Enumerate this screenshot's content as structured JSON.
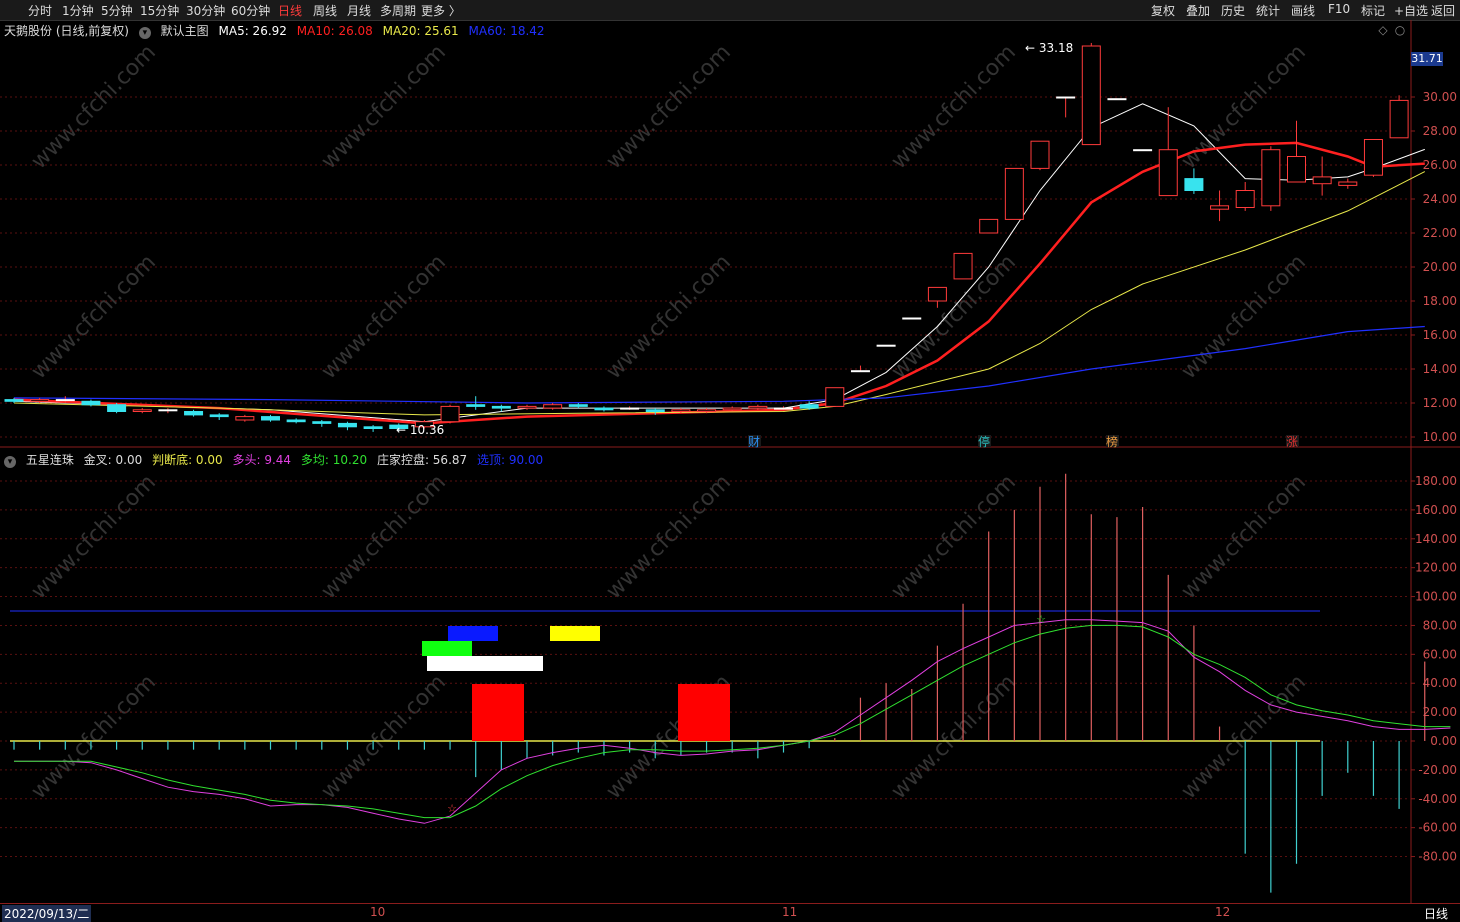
{
  "toolbar": {
    "periods": [
      "分时",
      "1分钟",
      "5分钟",
      "15分钟",
      "30分钟",
      "60分钟",
      "日线",
      "周线",
      "月线",
      "多周期",
      "更多 〉"
    ],
    "active": "日线",
    "right_buttons": [
      "复权",
      "叠加",
      "历史",
      "统计",
      "画线",
      "F10",
      "标记",
      "+自选",
      "返回"
    ]
  },
  "main_info": {
    "stock": "天鹅股份 (日线,前复权)",
    "template": "默认主图",
    "ma5": "MA5: 26.92",
    "ma10": "MA10: 26.08",
    "ma20": "MA20: 25.61",
    "ma60": "MA60: 18.42"
  },
  "colors": {
    "up": "#ff3b3b",
    "down": "#38e3ee",
    "ma5": "#ffffff",
    "ma10": "#ff2020",
    "ma20": "#e8e84a",
    "ma60": "#2030ff",
    "grid": "#5a1010",
    "axis": "#8a1c1c",
    "kdj_m": "#e040e0",
    "kdj_g": "#30e030"
  },
  "price_scale": {
    "highlight": "31.71",
    "ticks": [
      "30.00",
      "28.00",
      "26.00",
      "24.00",
      "22.00",
      "20.00",
      "18.00",
      "16.00",
      "14.00",
      "12.00",
      "10.00"
    ]
  },
  "annotations": {
    "high": "33.18",
    "low": "10.36"
  },
  "event_tags": [
    {
      "label": "财",
      "color": "#2a8ef0"
    },
    {
      "label": "停",
      "color": "#2ac0c0"
    },
    {
      "label": "榜",
      "color": "#e89a40"
    },
    {
      "label": "涨",
      "color": "#e03030"
    }
  ],
  "sub_info": {
    "name": "五星连珠",
    "jincha": "金叉: 0.00",
    "pandi": "判断底: 0.00",
    "duotou": "多头: 9.44",
    "duojun": "多均: 10.20",
    "kongpan": "庄家控盘: 56.87",
    "xuanding": "选顶: 90.00"
  },
  "sub_scale": {
    "ticks": [
      "180.00",
      "160.00",
      "140.00",
      "120.00",
      "100.00",
      "80.00",
      "60.00",
      "40.00",
      "20.00",
      "0.00",
      "-20.00",
      "-40.00",
      "-60.00",
      "-80.00"
    ]
  },
  "bottom": {
    "date": "2022/09/13/二",
    "months": [
      "10",
      "11",
      "12"
    ],
    "period": "日线"
  },
  "watermark": "www.cfchi.com",
  "chart_data": {
    "type": "candlestick",
    "price_ylim": [
      10,
      31.71
    ],
    "candles": [
      {
        "o": 12.2,
        "c": 12.1,
        "h": 12.3,
        "l": 12.0
      },
      {
        "o": 12.1,
        "c": 12.2,
        "h": 12.3,
        "l": 12.0
      },
      {
        "o": 12.2,
        "c": 12.2,
        "h": 12.4,
        "l": 12.0
      },
      {
        "o": 12.1,
        "c": 11.9,
        "h": 12.2,
        "l": 11.8
      },
      {
        "o": 11.9,
        "c": 11.5,
        "h": 12.0,
        "l": 11.4
      },
      {
        "o": 11.5,
        "c": 11.6,
        "h": 11.7,
        "l": 11.4
      },
      {
        "o": 11.6,
        "c": 11.6,
        "h": 11.7,
        "l": 11.4
      },
      {
        "o": 11.5,
        "c": 11.3,
        "h": 11.6,
        "l": 11.2
      },
      {
        "o": 11.3,
        "c": 11.2,
        "h": 11.4,
        "l": 11.0
      },
      {
        "o": 11.0,
        "c": 11.2,
        "h": 11.3,
        "l": 10.9
      },
      {
        "o": 11.2,
        "c": 11.0,
        "h": 11.3,
        "l": 10.9
      },
      {
        "o": 11.0,
        "c": 10.9,
        "h": 11.1,
        "l": 10.8
      },
      {
        "o": 10.9,
        "c": 10.8,
        "h": 11.0,
        "l": 10.6
      },
      {
        "o": 10.8,
        "c": 10.6,
        "h": 10.9,
        "l": 10.4
      },
      {
        "o": 10.6,
        "c": 10.5,
        "h": 10.7,
        "l": 10.3
      },
      {
        "o": 10.7,
        "c": 10.5,
        "h": 10.8,
        "l": 10.36
      },
      {
        "o": 10.6,
        "c": 10.9,
        "h": 11.0,
        "l": 10.5
      },
      {
        "o": 10.9,
        "c": 11.8,
        "h": 11.9,
        "l": 10.8
      },
      {
        "o": 11.9,
        "c": 11.8,
        "h": 12.4,
        "l": 11.6
      },
      {
        "o": 11.8,
        "c": 11.7,
        "h": 11.9,
        "l": 11.5
      },
      {
        "o": 11.7,
        "c": 11.8,
        "h": 11.9,
        "l": 11.6
      },
      {
        "o": 11.7,
        "c": 11.9,
        "h": 12.0,
        "l": 11.6
      },
      {
        "o": 11.9,
        "c": 11.8,
        "h": 12.0,
        "l": 11.7
      },
      {
        "o": 11.7,
        "c": 11.6,
        "h": 11.8,
        "l": 11.5
      },
      {
        "o": 11.7,
        "c": 11.7,
        "h": 11.8,
        "l": 11.6
      },
      {
        "o": 11.6,
        "c": 11.5,
        "h": 11.7,
        "l": 11.3
      },
      {
        "o": 11.5,
        "c": 11.6,
        "h": 11.7,
        "l": 11.4
      },
      {
        "o": 11.5,
        "c": 11.6,
        "h": 11.7,
        "l": 11.4
      },
      {
        "o": 11.6,
        "c": 11.7,
        "h": 11.8,
        "l": 11.5
      },
      {
        "o": 11.7,
        "c": 11.8,
        "h": 11.9,
        "l": 11.6
      },
      {
        "o": 11.7,
        "c": 11.7,
        "h": 11.8,
        "l": 11.6
      },
      {
        "o": 11.9,
        "c": 11.7,
        "h": 12.1,
        "l": 11.6
      },
      {
        "o": 11.8,
        "c": 12.9,
        "h": 12.9,
        "l": 11.8
      },
      {
        "o": 13.9,
        "c": 13.9,
        "h": 14.2,
        "l": 13.9
      },
      {
        "o": 15.4,
        "c": 15.4,
        "h": 15.4,
        "l": 15.4
      },
      {
        "o": 17.0,
        "c": 17.0,
        "h": 17.0,
        "l": 17.0
      },
      {
        "o": 18.0,
        "c": 18.8,
        "h": 18.8,
        "l": 17.6
      },
      {
        "o": 19.3,
        "c": 20.8,
        "h": 20.8,
        "l": 19.3
      },
      {
        "o": 22.0,
        "c": 22.8,
        "h": 22.8,
        "l": 22.0
      },
      {
        "o": 22.8,
        "c": 25.8,
        "h": 25.8,
        "l": 22.8
      },
      {
        "o": 25.8,
        "c": 27.4,
        "h": 27.4,
        "l": 25.7
      },
      {
        "o": 30.0,
        "c": 30.0,
        "h": 30.0,
        "l": 28.8
      },
      {
        "o": 27.2,
        "c": 33.0,
        "h": 33.18,
        "l": 27.2
      },
      {
        "o": 29.9,
        "c": 29.9,
        "h": 29.9,
        "l": 29.9
      },
      {
        "o": 26.9,
        "c": 26.9,
        "h": 26.9,
        "l": 26.9
      },
      {
        "o": 24.2,
        "c": 26.9,
        "h": 29.4,
        "l": 24.2
      },
      {
        "o": 25.2,
        "c": 24.5,
        "h": 25.8,
        "l": 24.3
      },
      {
        "o": 23.4,
        "c": 23.6,
        "h": 24.5,
        "l": 22.7
      },
      {
        "o": 23.5,
        "c": 24.5,
        "h": 25.0,
        "l": 23.3
      },
      {
        "o": 23.6,
        "c": 26.9,
        "h": 27.1,
        "l": 23.3
      },
      {
        "o": 25.0,
        "c": 26.5,
        "h": 28.6,
        "l": 25.0
      },
      {
        "o": 24.9,
        "c": 25.3,
        "h": 26.5,
        "l": 24.2
      },
      {
        "o": 24.8,
        "c": 25.0,
        "h": 25.2,
        "l": 24.6
      },
      {
        "o": 25.4,
        "c": 27.5,
        "h": 27.5,
        "l": 25.3
      },
      {
        "o": 27.6,
        "c": 29.8,
        "h": 30.1,
        "l": 27.6
      }
    ],
    "ma_series": [
      {
        "name": "MA5",
        "pts": [
          [
            0,
            12.1
          ],
          [
            10,
            11.6
          ],
          [
            16,
            10.9
          ],
          [
            20,
            11.7
          ],
          [
            30,
            11.7
          ],
          [
            32,
            12.2
          ],
          [
            34,
            13.8
          ],
          [
            36,
            16.5
          ],
          [
            38,
            20.0
          ],
          [
            40,
            24.5
          ],
          [
            42,
            28.2
          ],
          [
            44,
            29.6
          ],
          [
            46,
            28.3
          ],
          [
            48,
            25.2
          ],
          [
            50,
            25.1
          ],
          [
            52,
            25.3
          ],
          [
            53,
            25.8
          ],
          [
            55,
            26.92
          ]
        ]
      },
      {
        "name": "MA10",
        "pts": [
          [
            0,
            12.2
          ],
          [
            8,
            11.7
          ],
          [
            16,
            10.8
          ],
          [
            20,
            11.2
          ],
          [
            30,
            11.6
          ],
          [
            32,
            12.0
          ],
          [
            34,
            13.0
          ],
          [
            36,
            14.5
          ],
          [
            38,
            16.8
          ],
          [
            40,
            20.2
          ],
          [
            42,
            23.8
          ],
          [
            44,
            25.6
          ],
          [
            46,
            26.8
          ],
          [
            48,
            27.2
          ],
          [
            50,
            27.3
          ],
          [
            52,
            26.5
          ],
          [
            53,
            25.9
          ],
          [
            55,
            26.08
          ]
        ]
      },
      {
        "name": "MA20",
        "pts": [
          [
            0,
            12.0
          ],
          [
            8,
            11.7
          ],
          [
            16,
            11.3
          ],
          [
            22,
            11.4
          ],
          [
            30,
            11.5
          ],
          [
            32,
            11.8
          ],
          [
            34,
            12.5
          ],
          [
            38,
            14.0
          ],
          [
            40,
            15.5
          ],
          [
            42,
            17.5
          ],
          [
            44,
            19.0
          ],
          [
            48,
            21.0
          ],
          [
            52,
            23.3
          ],
          [
            55,
            25.61
          ]
        ]
      },
      {
        "name": "MA60",
        "pts": [
          [
            0,
            12.3
          ],
          [
            10,
            12.2
          ],
          [
            20,
            12.0
          ],
          [
            30,
            12.1
          ],
          [
            34,
            12.3
          ],
          [
            38,
            13.0
          ],
          [
            42,
            14.0
          ],
          [
            48,
            15.2
          ],
          [
            52,
            16.2
          ],
          [
            55,
            16.5
          ]
        ]
      }
    ],
    "sub_ylim": [
      -90,
      190
    ],
    "bars": [
      -6,
      -6,
      -6,
      -6,
      -6,
      -6,
      -6,
      -6,
      -6,
      -6,
      -6,
      -6,
      -6,
      -6,
      -6,
      -6,
      -6,
      -6,
      -25,
      -20,
      -12,
      -10,
      -8,
      -10,
      -8,
      -12,
      -10,
      -8,
      -8,
      -12,
      -8,
      -5,
      2,
      30,
      40,
      36,
      66,
      95,
      145,
      160,
      176,
      185,
      157,
      155,
      162,
      115,
      80,
      10,
      -78,
      -105,
      -85,
      -38,
      -22,
      -38,
      -47,
      55
    ],
    "magenta": [
      -14,
      -14,
      -14,
      -15,
      -20,
      -26,
      -32,
      -35,
      -37,
      -40,
      -45,
      -44,
      -44,
      -46,
      -50,
      -54,
      -57,
      -52,
      -36,
      -20,
      -12,
      -8,
      -5,
      -3,
      -5,
      -8,
      -10,
      -9,
      -7,
      -6,
      -3,
      0,
      6,
      18,
      30,
      42,
      55,
      64,
      72,
      80,
      82,
      84,
      84,
      83,
      82,
      76,
      58,
      48,
      35,
      25,
      20,
      17,
      14,
      10,
      8,
      8,
      9
    ],
    "green": [
      -14,
      -14,
      -14,
      -14,
      -18,
      -22,
      -27,
      -31,
      -34,
      -37,
      -41,
      -43,
      -44,
      -45,
      -47,
      -50,
      -53,
      -53,
      -45,
      -33,
      -24,
      -17,
      -12,
      -8,
      -6,
      -6,
      -7,
      -7,
      -6,
      -5,
      -3,
      0,
      4,
      12,
      22,
      32,
      42,
      52,
      60,
      68,
      74,
      78,
      80,
      80,
      79,
      72,
      60,
      53,
      44,
      32,
      25,
      21,
      18,
      14,
      12,
      10,
      10
    ],
    "xuanding_line": 90
  }
}
